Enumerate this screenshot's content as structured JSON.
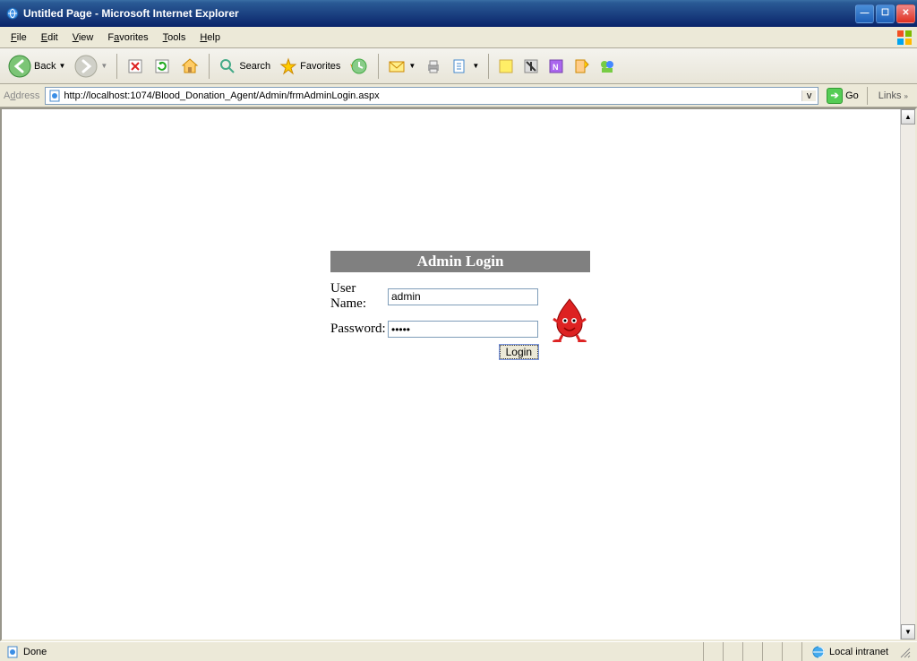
{
  "window": {
    "title": "Untitled Page - Microsoft Internet Explorer"
  },
  "menubar": {
    "file": "File",
    "edit": "Edit",
    "view": "View",
    "favorites": "Favorites",
    "tools": "Tools",
    "help": "Help"
  },
  "toolbar": {
    "back": "Back",
    "search": "Search",
    "favorites": "Favorites"
  },
  "addressbar": {
    "label": "Address",
    "url": "http://localhost:1074/Blood_Donation_Agent/Admin/frmAdminLogin.aspx",
    "go": "Go",
    "links": "Links"
  },
  "page": {
    "header": "Admin Login",
    "username_label": "User Name:",
    "username_value": "admin",
    "password_label": "Password:",
    "password_value": "•••••",
    "login_button": "Login"
  },
  "statusbar": {
    "status": "Done",
    "zone": "Local intranet"
  }
}
